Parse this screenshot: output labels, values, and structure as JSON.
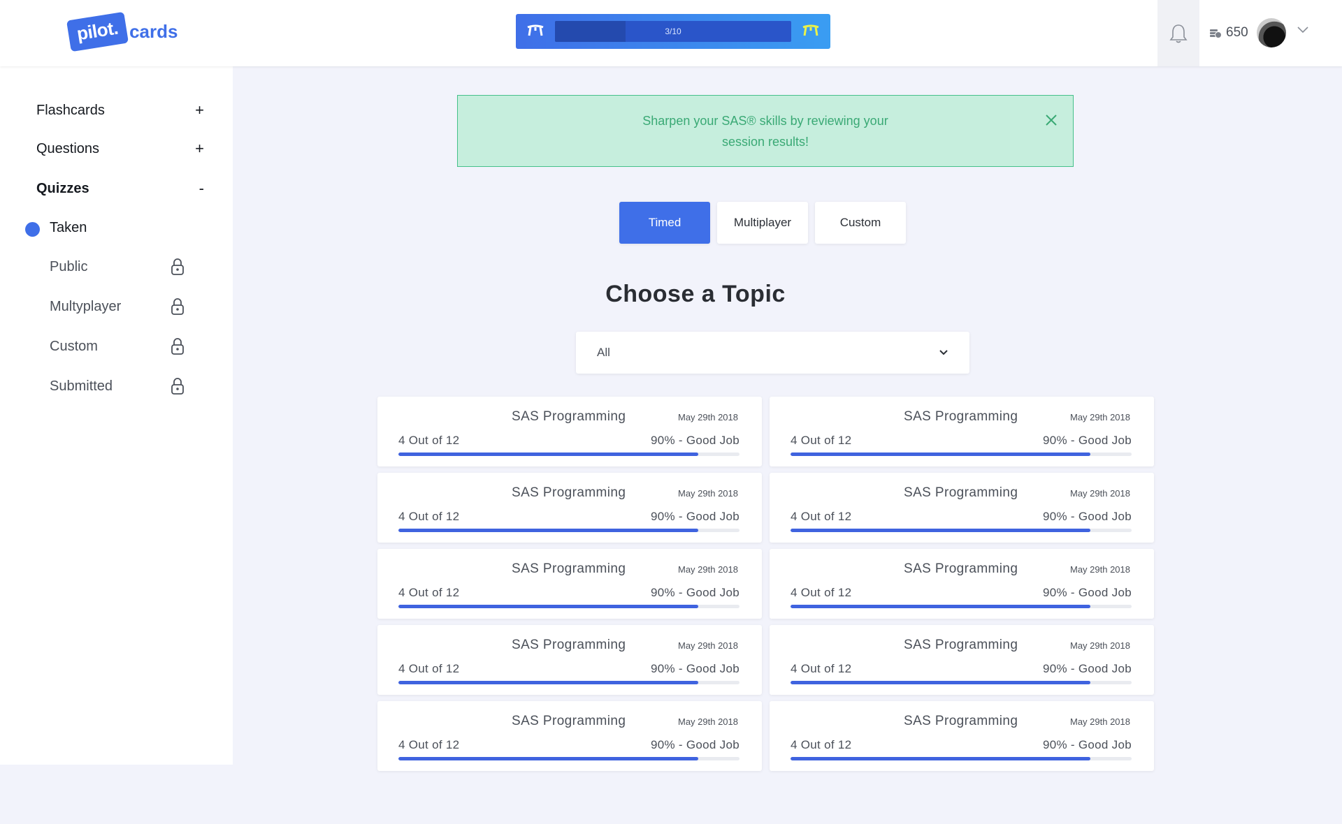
{
  "brand": {
    "badge": "pilot.",
    "word": "cards",
    "accent": "#3f6fe8"
  },
  "header": {
    "progress": {
      "label": "3/10",
      "current": 3,
      "total": 10
    },
    "coins": "650"
  },
  "sidebar": {
    "categories": [
      {
        "label": "Flashcards",
        "sign": "+"
      },
      {
        "label": "Questions",
        "sign": "+"
      },
      {
        "label": "Quizzes",
        "sign": "-"
      }
    ],
    "items": [
      {
        "label": "Taken",
        "active": true,
        "locked": false
      },
      {
        "label": "Public",
        "locked": true
      },
      {
        "label": "Multyplayer",
        "locked": true
      },
      {
        "label": "Custom",
        "locked": true
      },
      {
        "label": "Submitted",
        "locked": true
      }
    ]
  },
  "banner": {
    "message": "Sharpen your SAS® skills by reviewing your session results!"
  },
  "tabs": [
    {
      "label": "Timed",
      "active": true
    },
    {
      "label": "Multiplayer",
      "active": false
    },
    {
      "label": "Custom",
      "active": false
    }
  ],
  "main": {
    "heading": "Choose a Topic",
    "topic_select": {
      "value": "All"
    }
  },
  "results": [
    {
      "title": "SAS Programming",
      "date": "May 29th 2018",
      "count": "4 Out of 12",
      "score": "90% - Good Job",
      "progress": 0.88
    },
    {
      "title": "SAS Programming",
      "date": "May 29th 2018",
      "count": "4 Out of 12",
      "score": "90% - Good Job",
      "progress": 0.88
    },
    {
      "title": "SAS Programming",
      "date": "May 29th 2018",
      "count": "4 Out of 12",
      "score": "90% - Good Job",
      "progress": 0.88
    },
    {
      "title": "SAS Programming",
      "date": "May 29th 2018",
      "count": "4 Out of 12",
      "score": "90% - Good Job",
      "progress": 0.88
    },
    {
      "title": "SAS Programming",
      "date": "May 29th 2018",
      "count": "4 Out of 12",
      "score": "90% - Good Job",
      "progress": 0.88
    },
    {
      "title": "SAS Programming",
      "date": "May 29th 2018",
      "count": "4 Out of 12",
      "score": "90% - Good Job",
      "progress": 0.88
    },
    {
      "title": "SAS Programming",
      "date": "May 29th 2018",
      "count": "4 Out of 12",
      "score": "90% - Good Job",
      "progress": 0.88
    },
    {
      "title": "SAS Programming",
      "date": "May 29th 2018",
      "count": "4 Out of 12",
      "score": "90% - Good Job",
      "progress": 0.88
    },
    {
      "title": "SAS Programming",
      "date": "May 29th 2018",
      "count": "4 Out of 12",
      "score": "90% - Good Job",
      "progress": 0.88
    },
    {
      "title": "SAS Programming",
      "date": "May 29th 2018",
      "count": "4 Out of 12",
      "score": "90% - Good Job",
      "progress": 0.88
    }
  ]
}
